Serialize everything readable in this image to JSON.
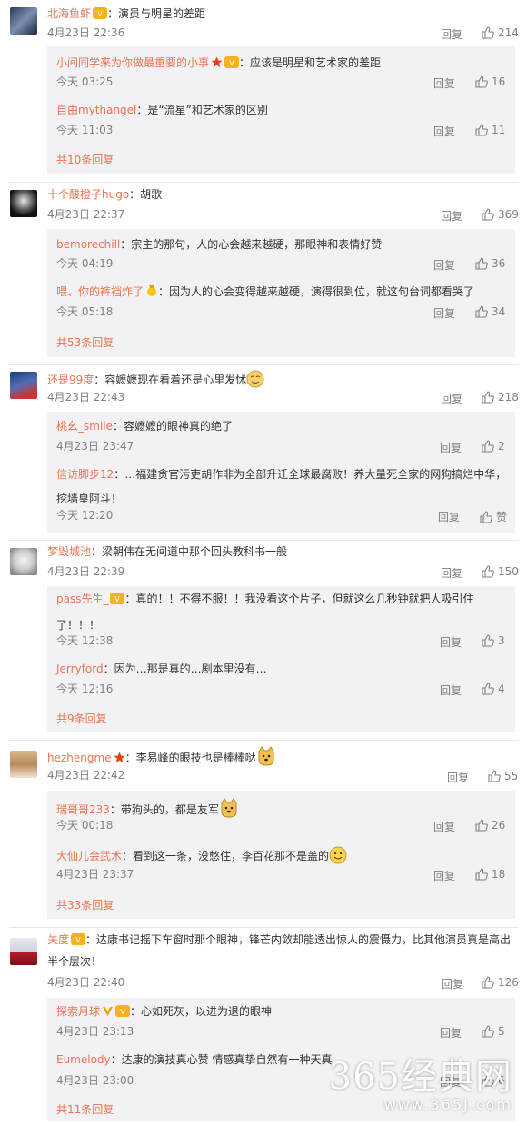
{
  "ui": {
    "reply_label": "回复",
    "accent_color": "#eb7350",
    "reply_bg": "#f2f2f5"
  },
  "comments": [
    {
      "user": "北海鱼虾",
      "text": "：演员与明星的差距",
      "time": "4月23日 22:36",
      "likes": "214",
      "replies": [
        {
          "user": "小间同学来为你做最重要的小事",
          "text": "：应该是明星和艺术家的差距",
          "time": "今天 03:25",
          "likes": "16"
        },
        {
          "user": "自由mythangel",
          "text": "：是“流星”和艺术家的区别",
          "time": "今天 11:03",
          "likes": "11"
        }
      ],
      "more": "共10条回复"
    },
    {
      "user": "十个酸橙子hugo",
      "text": "：胡歌",
      "time": "4月23日 22:37",
      "likes": "369",
      "replies": [
        {
          "user": "bemorechill",
          "text": "：宗主的那句，人的心会越来越硬，那眼神和表情好赞",
          "time": "今天 04:19",
          "likes": "36"
        },
        {
          "user": "喂、你的裤裆炸了",
          "text": "：因为人的心会变得越来越硬，演得很到位，就这句台词都看哭了",
          "time": "今天 05:18",
          "likes": "34"
        }
      ],
      "more": "共53条回复"
    },
    {
      "user": "还是99度",
      "text": "：容嬷嬷现在看着还是心里发怵",
      "time": "4月23日 22:43",
      "likes": "218",
      "replies": [
        {
          "user": "桃幺_smile",
          "text": "：容嬷嬷的眼神真的绝了",
          "time": "4月23日 23:47",
          "likes": "2"
        },
        {
          "user": "信访脚步12",
          "text": "：…福建贪官污吏胡作非为全部升迁全球最腐败！养大量死全家的网狗搞烂中华，挖墙皇阿斗！",
          "time": "今天 12:20",
          "likes": "赞"
        }
      ],
      "more": ""
    },
    {
      "user": "梦毁城池",
      "text": "：梁朝伟在无间道中那个回头教科书一般",
      "time": "4月23日 22:39",
      "likes": "150",
      "replies": [
        {
          "user": "pass先生_",
          "text": "：真的！！不得不服！！我没看这个片子，但就这么几秒钟就把人吸引住了！！！",
          "time": "今天 12:38",
          "likes": "3"
        },
        {
          "user": "Jerryford",
          "text": "：因为…那是真的…剧本里没有…",
          "time": "今天 12:16",
          "likes": "4"
        }
      ],
      "more": "共9条回复"
    },
    {
      "user": "hezhengme",
      "text": "：李易峰的眼技也是棒棒哒",
      "time": "4月23日 22:42",
      "likes": "55",
      "replies": [
        {
          "user": "瑞哥哥233",
          "text": "：带狗头的，都是友军",
          "time": "今天 00:18",
          "likes": "26"
        },
        {
          "user": "大仙儿会武术",
          "text": "：看到这一条，没憋住，李百花那不是盖的",
          "time": "4月23日 23:37",
          "likes": "18"
        }
      ],
      "more": "共33条回复"
    },
    {
      "user": "关度",
      "text": "：达康书记摇下车窗时那个眼神，锋芒内敛却能透出惊人的震慑力，比其他演员真是高出半个层次！",
      "time": "4月23日 22:40",
      "likes": "126",
      "replies": [
        {
          "user": "探索月球",
          "text": "：心如死灰，以进为退的眼神",
          "time": "4月23日 23:13",
          "likes": "5"
        },
        {
          "user": "Eumelody",
          "text": "：达康的演技真心赞 情感真挚自然有一种天真",
          "time": "4月23日 23:00",
          "likes": "6"
        }
      ],
      "more": "共11条回复"
    }
  ],
  "watermark": {
    "main": "365经典网",
    "sub": "www.365J.com"
  }
}
